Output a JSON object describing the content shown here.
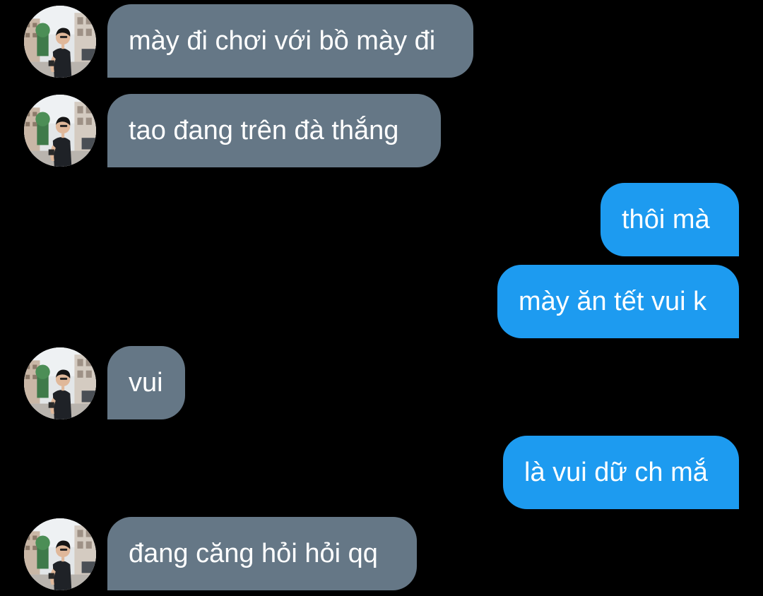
{
  "conversation": {
    "messages": [
      {
        "sender": "contact",
        "text": "mày đi chơi với bồ mày đi"
      },
      {
        "sender": "contact",
        "text": "tao đang trên đà thắng"
      },
      {
        "sender": "me",
        "text": "thôi mà"
      },
      {
        "sender": "me",
        "text": "mày ăn tết vui k"
      },
      {
        "sender": "contact",
        "text": "vui"
      },
      {
        "sender": "me",
        "text": "là vui dữ ch mắ"
      },
      {
        "sender": "contact",
        "text": "đang căng hỏi hỏi qq"
      }
    ]
  },
  "colors": {
    "background": "#000000",
    "incoming_bubble": "#657786",
    "outgoing_bubble": "#1d9bf0",
    "text": "#ffffff"
  },
  "icons": {
    "avatar": "contact-avatar-photo"
  }
}
